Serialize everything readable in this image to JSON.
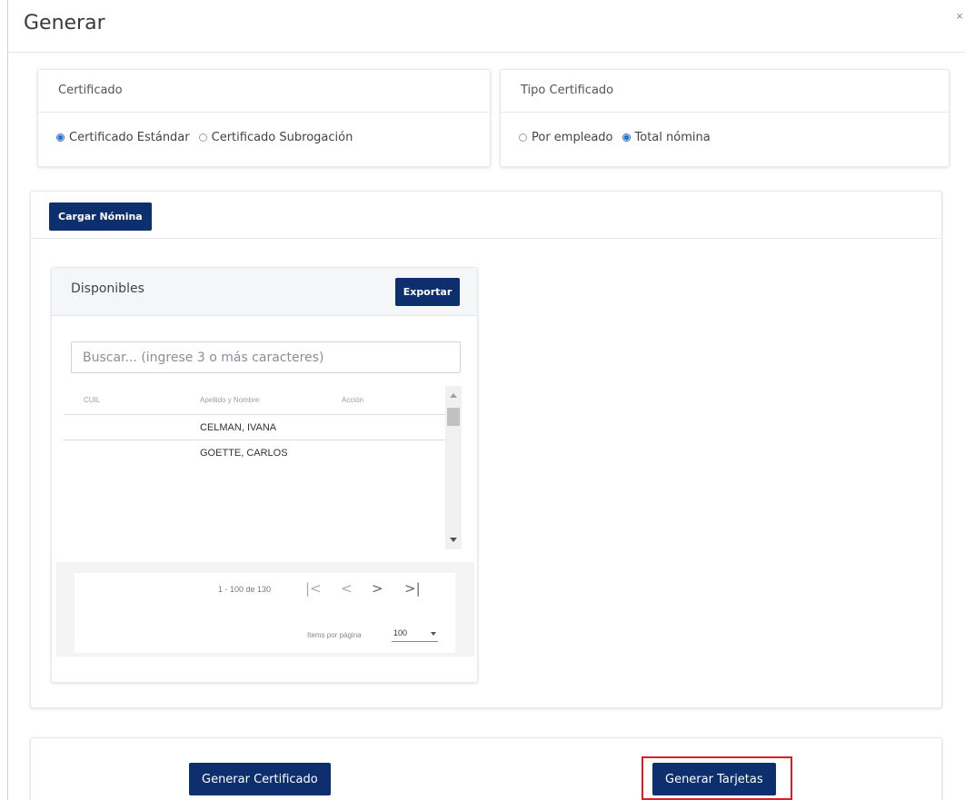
{
  "modal": {
    "title": "Generar",
    "close_icon": "×"
  },
  "certificado": {
    "title": "Certificado",
    "options": [
      {
        "label": "Certificado Estándar",
        "selected": true
      },
      {
        "label": "Certificado Subrogación",
        "selected": false
      }
    ]
  },
  "tipo_certificado": {
    "title": "Tipo Certificado",
    "options": [
      {
        "label": "Por empleado",
        "selected": false
      },
      {
        "label": "Total nómina",
        "selected": true
      }
    ]
  },
  "nomina": {
    "cargar_label": "Cargar Nómina",
    "disponibles": {
      "title": "Disponibles",
      "export_label": "Exportar",
      "search_placeholder": "Buscar... (ingrese 3 o más caracteres)",
      "columns": [
        "CUIL",
        "Apellido y Nombre",
        "Acción"
      ],
      "rows": [
        {
          "cuil": "",
          "name": "CELMAN, IVANA",
          "accion": ""
        },
        {
          "cuil": "",
          "name": "GOETTE, CARLOS",
          "accion": ""
        }
      ],
      "paginator": {
        "range": "1 - 100 de 130",
        "first": "|<",
        "prev": "<",
        "next": ">",
        "last": ">|",
        "items_per_page_label": "Items por página",
        "items_per_page": "100"
      }
    }
  },
  "footer": {
    "generar_certificado": "Generar Certificado",
    "generar_tarjetas": "Generar Tarjetas"
  },
  "colors": {
    "primary": "#0d2f6e",
    "radio_selected": "#2a6fdb",
    "highlight": "#e01c24"
  }
}
